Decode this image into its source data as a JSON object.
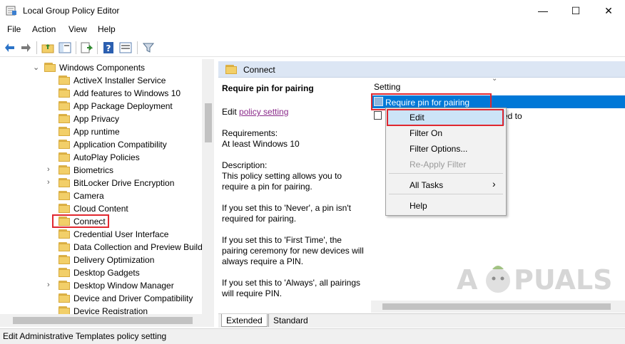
{
  "window": {
    "title": "Local Group Policy Editor",
    "minimize": "—",
    "maximize": "☐",
    "close": "✕"
  },
  "menu": [
    "File",
    "Action",
    "View",
    "Help"
  ],
  "tree": {
    "items": [
      {
        "label": "Windows Components",
        "expanded": true,
        "level": 0
      },
      {
        "label": "ActiveX Installer Service",
        "level": 1
      },
      {
        "label": "Add features to Windows 10",
        "level": 1
      },
      {
        "label": "App Package Deployment",
        "level": 1
      },
      {
        "label": "App Privacy",
        "level": 1
      },
      {
        "label": "App runtime",
        "level": 1
      },
      {
        "label": "Application Compatibility",
        "level": 1
      },
      {
        "label": "AutoPlay Policies",
        "level": 1
      },
      {
        "label": "Biometrics",
        "level": 1,
        "expandable": true
      },
      {
        "label": "BitLocker Drive Encryption",
        "level": 1,
        "expandable": true
      },
      {
        "label": "Camera",
        "level": 1
      },
      {
        "label": "Cloud Content",
        "level": 1
      },
      {
        "label": "Connect",
        "level": 1,
        "highlighted": true
      },
      {
        "label": "Credential User Interface",
        "level": 1
      },
      {
        "label": "Data Collection and Preview Build",
        "level": 1
      },
      {
        "label": "Delivery Optimization",
        "level": 1
      },
      {
        "label": "Desktop Gadgets",
        "level": 1
      },
      {
        "label": "Desktop Window Manager",
        "level": 1,
        "expandable": true
      },
      {
        "label": "Device and Driver Compatibility",
        "level": 1
      },
      {
        "label": "Device Registration",
        "level": 1
      }
    ]
  },
  "right": {
    "header_title": "Connect",
    "desc": {
      "title": "Require pin for pairing",
      "edit_prefix": "Edit",
      "edit_link": "policy setting",
      "requirements_label": "Requirements:",
      "requirements_value": "At least Windows 10",
      "description_label": "Description:",
      "d1": "This policy setting allows you to",
      "d2": "require a pin for pairing.",
      "d3": "If you set this to 'Never', a pin isn't",
      "d4": "required for pairing.",
      "d5": "If you set this to 'First Time', the",
      "d6": "pairing ceremony for new devices will",
      "d7": "always require a PIN.",
      "d8": "If you set this to 'Always', all pairings",
      "d9": "will require PIN."
    },
    "column_header": "Setting",
    "rows": [
      {
        "label": "Require pin for pairing",
        "selected": true
      },
      {
        "label": "ed to",
        "selected": false
      }
    ]
  },
  "context_menu": {
    "items": [
      "Edit",
      "Filter On",
      "Filter Options...",
      "Re-Apply Filter",
      "All Tasks",
      "Help"
    ],
    "disabled": [
      "Re-Apply Filter"
    ],
    "submenu_arrow": "›"
  },
  "tabs": [
    "Extended",
    "Standard"
  ],
  "status": "Edit Administrative Templates policy setting",
  "colors": {
    "selection": "#0078d7",
    "header_bg": "#dce6f4",
    "highlight_red": "#e0282f",
    "link": "#8a2a8a"
  }
}
